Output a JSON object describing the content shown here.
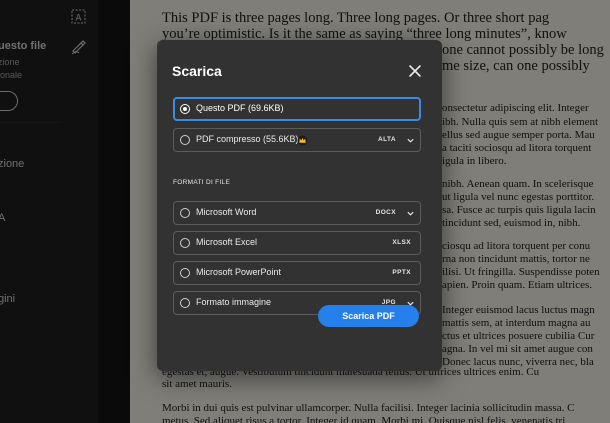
{
  "sidebar": {
    "file_title": "uesto file",
    "line1": "zione",
    "line2": "ionale",
    "item1": "zione",
    "item2": "A",
    "item3": "gini"
  },
  "document": {
    "lines_big": [
      "This PDF is three pages long. Three long pages. Or three short pag",
      "you’re optimistic. Is it the same as saying “three long minutes”, know",
      "one cannot possibly be long",
      "me size, can one possibly"
    ],
    "lines_small": [
      "onsectetur adipiscing elit. Integer",
      "ibh. Nulla quis sem at nibh element",
      "ellus sed augue semper porta. Mau",
      "a taciti sociosqu ad litora torquent",
      "igula in libero.",
      "nibh. Aenean quam. In scelerisque",
      "ut ligula vel nunc egestas porttitor.",
      "sa. Fusce ac turpis quis ligula lacin",
      "tincidunt sed, euismod in, nibh.",
      "ciosqu ad litora torquent per conu",
      "rna non tincidunt mattis, tortor ne",
      "ilisi. Ut fringilla. Suspendisse poten",
      "apien. Proin quam. Etiam ultrices.",
      "Integer euismod lacus luctus magn",
      "mattis sem, at interdum magna au",
      "ctus et ultrices posuere cubilia Cur",
      "agna. In vel mi sit amet augue con",
      "Donec lacus nunc, viverra nec, bla",
      "egestas et, augue. Vestibulum tincidunt malesuada tellus. Ut ultrices ultrices enim. Cu",
      "sit amet mauris.",
      "Morbi in dui quis est pulvinar ullamcorper. Nulla facilisi. Integer lacinia sollicitudin massa. C",
      "metus. Sed aliquet risus a tortor. Integer id quam. Morbi mi. Quisque nisl felis, venenatis tri"
    ]
  },
  "dialog": {
    "title": "Scarica",
    "options_top": [
      {
        "label": "Questo PDF (69.6KB)",
        "selected": true
      },
      {
        "label": "PDF compresso (55.6KB)",
        "tag": "ALTA",
        "premium_icon": "crown-icon"
      }
    ],
    "section_label": "FORMATI DI FILE",
    "formats": [
      {
        "label": "Microsoft Word",
        "tag": "DOCX",
        "has_dropdown": true
      },
      {
        "label": "Microsoft Excel",
        "tag": "XLSX",
        "has_dropdown": false
      },
      {
        "label": "Microsoft PowerPoint",
        "tag": "PPTX",
        "has_dropdown": false
      },
      {
        "label": "Formato immagine",
        "tag": "JPG",
        "has_dropdown": true
      }
    ],
    "download_button": "Scarica PDF"
  },
  "colors": {
    "accent": "#2680eb",
    "dialog_bg": "#323232",
    "selection_border": "#3b8ae6",
    "crown": "#f5c518"
  }
}
